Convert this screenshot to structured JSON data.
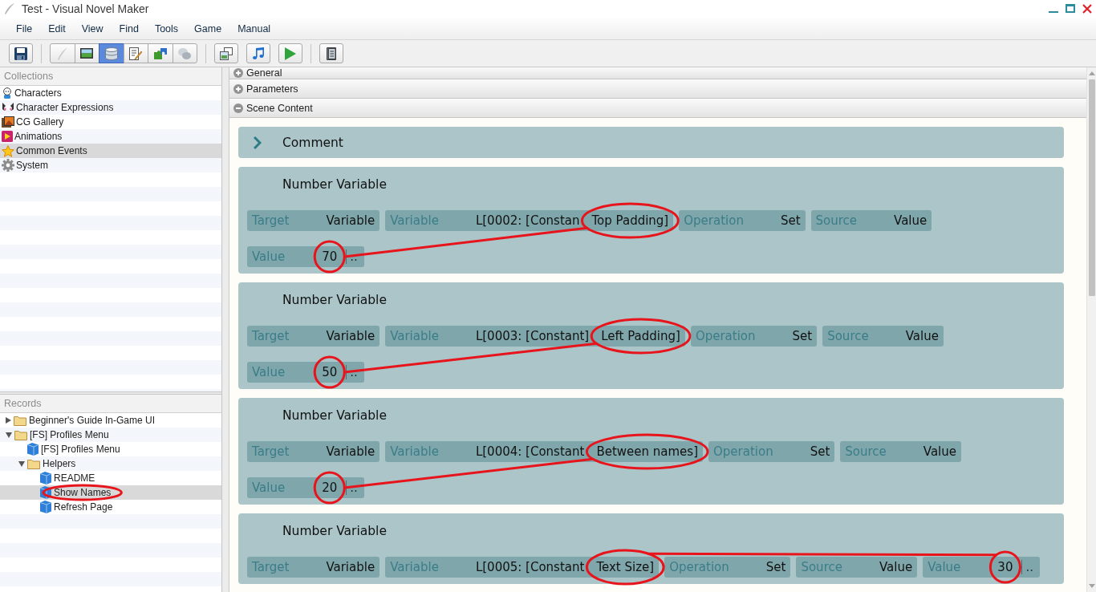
{
  "window": {
    "title": "Test - Visual Novel Maker"
  },
  "menu": [
    "File",
    "Edit",
    "View",
    "Find",
    "Tools",
    "Game",
    "Manual"
  ],
  "toolbar": {
    "groups": [
      {
        "kind": "buttons",
        "items": [
          {
            "selected": false,
            "disabled": false
          }
        ]
      },
      {
        "kind": "segmented",
        "items": [
          {
            "selected": false,
            "disabled": true
          },
          {
            "selected": false,
            "disabled": false
          },
          {
            "selected": true,
            "disabled": false
          },
          {
            "selected": false,
            "disabled": false
          },
          {
            "selected": false,
            "disabled": false
          },
          {
            "selected": false,
            "disabled": false
          }
        ]
      },
      {
        "kind": "buttons",
        "items": [
          {
            "selected": false,
            "disabled": false
          },
          {
            "selected": false,
            "disabled": false
          },
          {
            "selected": false,
            "disabled": false
          }
        ]
      },
      {
        "kind": "buttons",
        "items": [
          {
            "selected": false,
            "disabled": false
          }
        ]
      }
    ]
  },
  "collections": {
    "title": "Collections",
    "items": [
      {
        "label": "Characters",
        "selected": false
      },
      {
        "label": "Character Expressions",
        "selected": false
      },
      {
        "label": "CG Gallery",
        "selected": false
      },
      {
        "label": "Animations",
        "selected": false
      },
      {
        "label": "Common Events",
        "selected": true
      },
      {
        "label": "System",
        "selected": false
      }
    ]
  },
  "records": {
    "title": "Records",
    "items": [
      {
        "label": "Beginner's Guide In-Game UI",
        "kind": "folder",
        "expanded": false,
        "selected": false,
        "circled": false
      },
      {
        "label": "[FS] Profiles Menu",
        "kind": "folder",
        "expanded": true,
        "selected": false,
        "circled": false,
        "children": [
          {
            "label": "[FS] Profiles Menu",
            "kind": "record",
            "selected": false,
            "circled": false
          },
          {
            "label": "Helpers",
            "kind": "folder",
            "expanded": true,
            "selected": false,
            "circled": false,
            "children": [
              {
                "label": "README",
                "kind": "record",
                "selected": false,
                "circled": false
              },
              {
                "label": "Show Names",
                "kind": "record",
                "selected": true,
                "circled": true
              },
              {
                "label": "Refresh Page",
                "kind": "record",
                "selected": false,
                "circled": false
              }
            ]
          }
        ]
      }
    ]
  },
  "sections": [
    {
      "label": "General",
      "expanded": false
    },
    {
      "label": "Parameters",
      "expanded": false
    },
    {
      "label": "Scene Content",
      "expanded": true
    }
  ],
  "commands": [
    {
      "kind": "comment",
      "title": "Comment"
    },
    {
      "kind": "number-variable",
      "title": "Number Variable",
      "linked": true,
      "field_rows": [
        [
          {
            "label": "Target",
            "value": "Variable",
            "circled": false
          },
          {
            "label": "Variable",
            "value": "L[0002: [Constan",
            "circled": false,
            "name": {
              "text": "Top Padding]",
              "circled": true
            }
          },
          {
            "label": "Operation",
            "value": "Set",
            "circled": false
          },
          {
            "label": "Source",
            "value": "Value",
            "circled": false
          }
        ],
        [
          {
            "label": "Value",
            "value": "70",
            "circled": true,
            "button": ".."
          }
        ]
      ]
    },
    {
      "kind": "number-variable",
      "title": "Number Variable",
      "linked": true,
      "field_rows": [
        [
          {
            "label": "Target",
            "value": "Variable",
            "circled": false
          },
          {
            "label": "Variable",
            "value": "L[0003: [Constant]",
            "circled": false,
            "name": {
              "text": "Left Padding]",
              "circled": true
            }
          },
          {
            "label": "Operation",
            "value": "Set",
            "circled": false
          },
          {
            "label": "Source",
            "value": "Value",
            "circled": false
          }
        ],
        [
          {
            "label": "Value",
            "value": "50",
            "circled": true,
            "button": ".."
          }
        ]
      ]
    },
    {
      "kind": "number-variable",
      "title": "Number Variable",
      "linked": true,
      "field_rows": [
        [
          {
            "label": "Target",
            "value": "Variable",
            "circled": false
          },
          {
            "label": "Variable",
            "value": "L[0004: [Constant",
            "circled": false,
            "name": {
              "text": "Between names]",
              "circled": true
            }
          },
          {
            "label": "Operation",
            "value": "Set",
            "circled": false
          },
          {
            "label": "Source",
            "value": "Value",
            "circled": false
          }
        ],
        [
          {
            "label": "Value",
            "value": "20",
            "circled": true,
            "button": ".."
          }
        ]
      ]
    },
    {
      "kind": "number-variable",
      "title": "Number Variable",
      "linked": true,
      "field_rows": [
        [
          {
            "label": "Target",
            "value": "Variable",
            "circled": false
          },
          {
            "label": "Variable",
            "value": "L[0005: [Constant",
            "circled": false,
            "name": {
              "text": "Text Size]",
              "circled": true
            }
          },
          {
            "label": "Operation",
            "value": "Set",
            "circled": false
          },
          {
            "label": "Source",
            "value": "Value",
            "circled": false
          },
          {
            "label": "Value",
            "value": "30",
            "circled": true,
            "button": ".."
          }
        ]
      ]
    }
  ]
}
